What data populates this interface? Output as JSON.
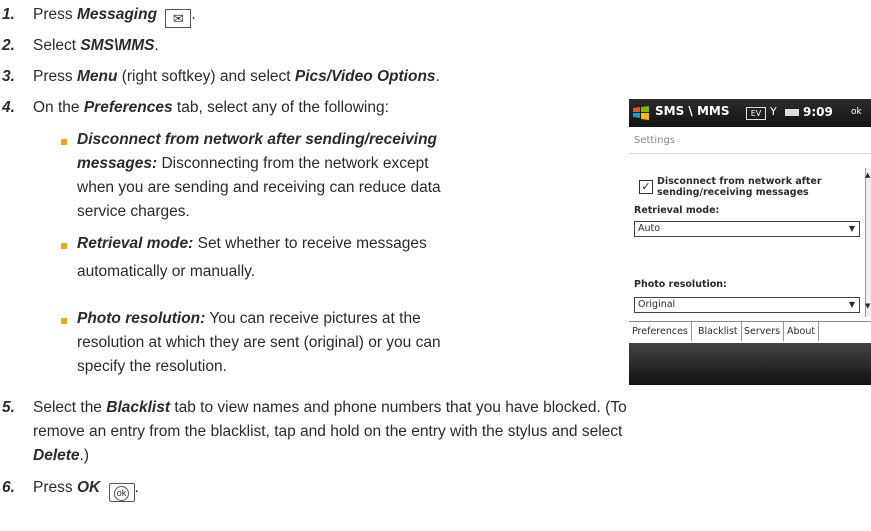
{
  "steps": [
    {
      "num": "1.",
      "pre": "Press ",
      "em": "Messaging",
      "icon": "envelope-icon",
      "glyph": "✉",
      "post": "."
    },
    {
      "num": "2.",
      "pre": "Select ",
      "em": "SMS\\MMS",
      "post": "."
    },
    {
      "num": "3.",
      "pre": "Press ",
      "em": "Menu",
      "mid": " (right softkey) and select ",
      "em2": "Pics/Video Options",
      "post": "."
    },
    {
      "num": "4.",
      "pre": "On the ",
      "em": "Preferences",
      "post": " tab, select any of the following:"
    },
    {
      "num": "5.",
      "pre": "Select the ",
      "em": "Blacklist",
      "post": " tab to view names and phone numbers that you have blocked. (To",
      "line2": "remove an entry from the blacklist, tap and hold on the entry with the stylus and select",
      "em3": "Delete",
      "post3": ".)"
    },
    {
      "num": "6.",
      "pre": "Press ",
      "em": "OK",
      "icon": "ok-key-icon",
      "glyph": "ok",
      "post": "."
    }
  ],
  "bullets": [
    {
      "term": "Disconnect from network after sending/receiving",
      "term2": "messages:",
      "desc": " Disconnecting from the network except",
      "lines": [
        "when you are sending and receiving can reduce data",
        "service charges."
      ]
    },
    {
      "term": "Retrieval mode:",
      "desc": " Set whether to receive messages",
      "lines": [
        "automatically or manually."
      ]
    },
    {
      "term": "Photo resolution:",
      "desc": " You can receive pictures at the",
      "lines": [
        "resolution at which they are sent (original) or you can",
        "specify the resolution."
      ]
    }
  ],
  "phone": {
    "title": "SMS \\ MMS",
    "ev": "EV",
    "signal": "Y",
    "time": "9:09",
    "ok": "ok",
    "settings": "Settings",
    "checkbox_label": "Disconnect from network after sending/receiving messages",
    "checkbox_checked": true,
    "retrieval_label": "Retrieval mode:",
    "retrieval_value": "Auto",
    "photo_label": "Photo resolution:",
    "photo_value": "Original",
    "tabs": [
      "Preferences",
      "Blacklist",
      "Servers",
      "About"
    ],
    "active_tab": "Preferences"
  },
  "colors": {
    "bullet": "#f0a818",
    "text": "#2b2b2b"
  }
}
